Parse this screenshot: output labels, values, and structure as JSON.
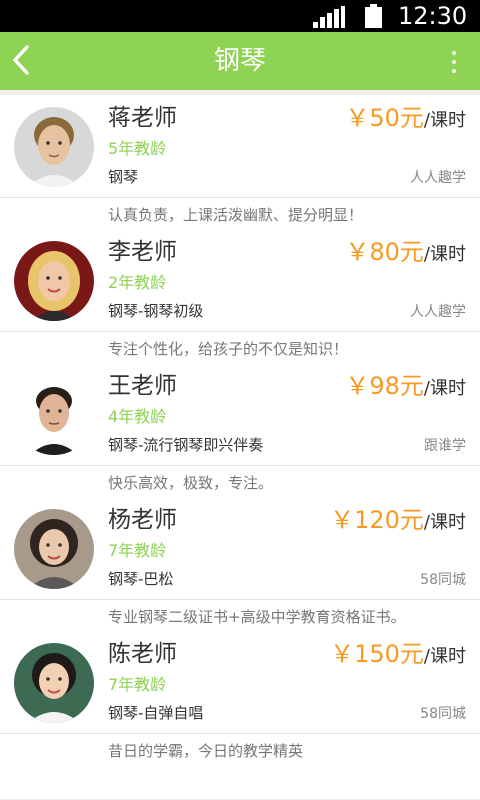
{
  "status_bar": {
    "time": "12:30"
  },
  "app_bar": {
    "title": "钢琴"
  },
  "teachers": [
    {
      "name": "蒋老师",
      "price": "￥50元",
      "unit": "/课时",
      "experience": "5年教龄",
      "course": "钢琴",
      "source": "人人趣学",
      "motto": "认真负责，上课活泼幽默、提分明显！"
    },
    {
      "name": "李老师",
      "price": "￥80元",
      "unit": "/课时",
      "experience": "2年教龄",
      "course": "钢琴-钢琴初级",
      "source": "人人趣学",
      "motto": "专注个性化，给孩子的不仅是知识！"
    },
    {
      "name": "王老师",
      "price": "￥98元",
      "unit": "/课时",
      "experience": "4年教龄",
      "course": "钢琴-流行钢琴即兴伴奏",
      "source": "跟谁学",
      "motto": "快乐高效，极致，专注。"
    },
    {
      "name": "杨老师",
      "price": "￥120元",
      "unit": "/课时",
      "experience": "7年教龄",
      "course": "钢琴-巴松",
      "source": "58同城",
      "motto": "专业钢琴二级证书+高级中学教育资格证书。"
    },
    {
      "name": "陈老师",
      "price": "￥150元",
      "unit": "/课时",
      "experience": "7年教龄",
      "course": "钢琴-自弹自唱",
      "source": "58同城",
      "motto": "昔日的学霸，今日的教学精英"
    }
  ]
}
